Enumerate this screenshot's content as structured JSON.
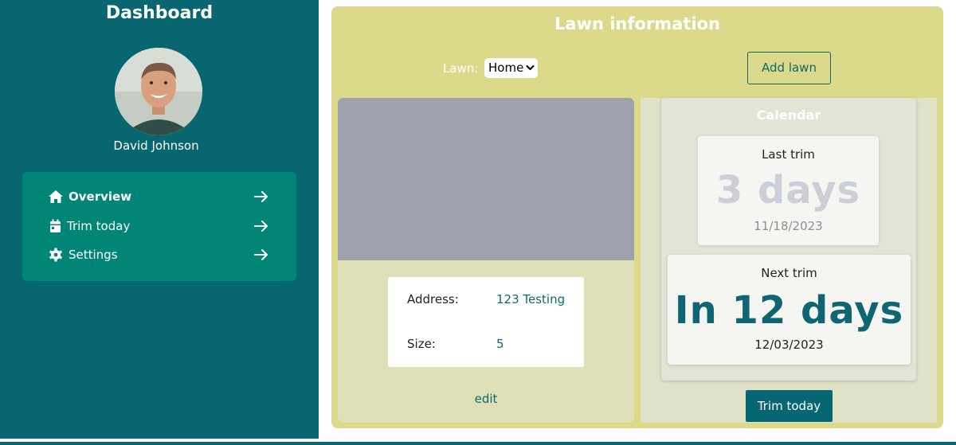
{
  "sidebar": {
    "title": "Dashboard",
    "user_name": "David Johnson",
    "nav": [
      {
        "label": "Overview",
        "icon": "home-icon",
        "active": true
      },
      {
        "label": "Trim today",
        "icon": "calendar-icon",
        "active": false
      },
      {
        "label": "Settings",
        "icon": "gear-icon",
        "active": false
      }
    ]
  },
  "main": {
    "title": "Lawn information",
    "lawn_label": "Lawn:",
    "lawn_selected": "Home",
    "add_lawn_label": "Add lawn",
    "lawn": {
      "address_label": "Address:",
      "address_value": "123 Testing",
      "size_label": "Size:",
      "size_value": "5",
      "edit_label": "edit"
    },
    "calendar": {
      "title": "Calendar",
      "last_trim_label": "Last trim",
      "last_trim_days": "3 days",
      "last_trim_date": "11/18/2023",
      "next_trim_label": "Next trim",
      "next_trim_days": "In 12 days",
      "next_trim_date": "12/03/2023",
      "trim_today_label": "Trim today"
    }
  },
  "colors": {
    "sidebar_bg": "#086670",
    "nav_bg": "#008577",
    "main_bg": "#dcd98a",
    "accent": "#0f6672",
    "photo_placeholder": "#9ca1ab"
  }
}
